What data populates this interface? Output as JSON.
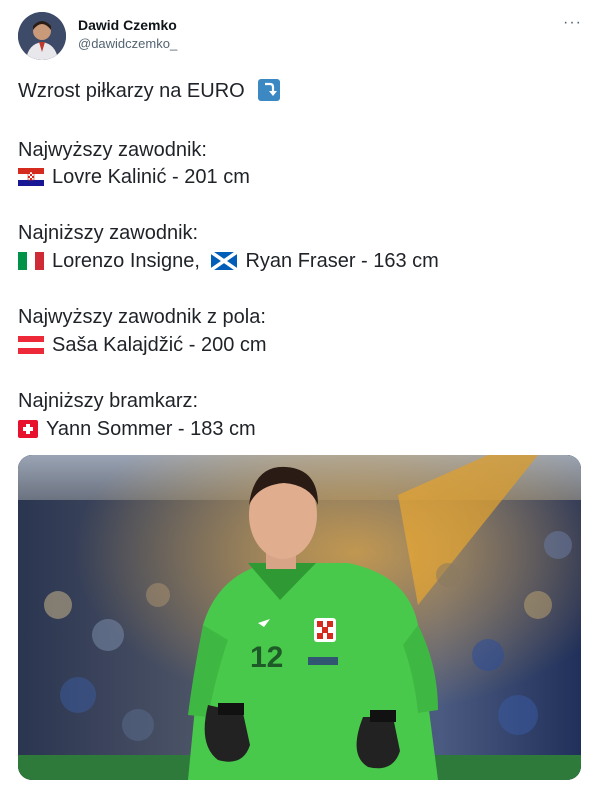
{
  "author": {
    "display_name": "Dawid Czemko",
    "handle": "@dawidczemko_",
    "more_label": "···"
  },
  "tweet": {
    "title": "Wzrost piłkarzy na EURO",
    "tallest_heading": "Najwyższy zawodnik:",
    "tallest_value": "Lovre Kalinić - 201 cm",
    "shortest_heading": "Najniższy zawodnik:",
    "shortest_player_1": "Lorenzo Insigne,",
    "shortest_player_2": "Ryan Fraser - 163 cm",
    "tallest_outfield_heading": "Najwyższy zawodnik z pola:",
    "tallest_outfield_value": "Saša Kalajdžić - 200 cm",
    "shortest_gk_heading": "Najniższy bramkarz:",
    "shortest_gk_value": "Yann Sommer - 183 cm"
  },
  "photo": {
    "shirt_number": "12"
  },
  "colors": {
    "jersey": "#49c94b",
    "link_blue": "#3b88c3"
  }
}
